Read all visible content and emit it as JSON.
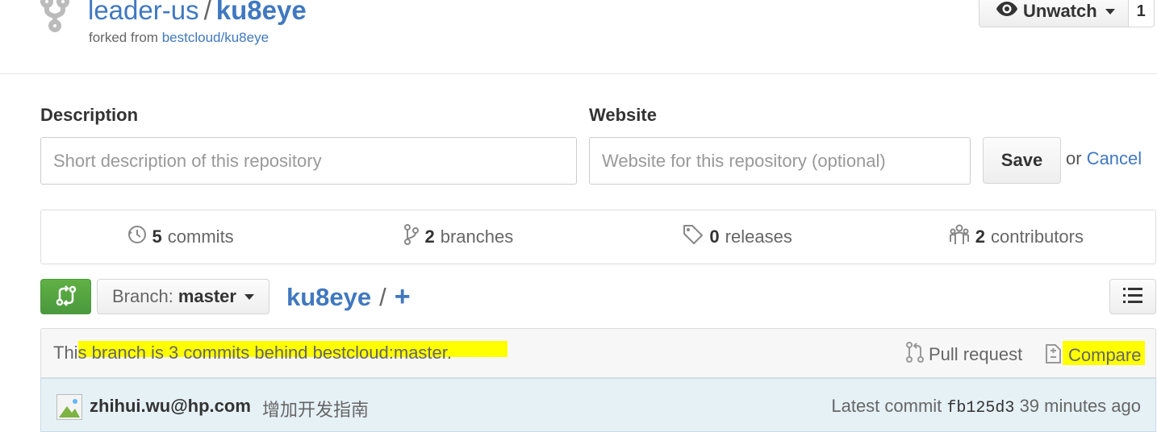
{
  "repo": {
    "owner": "leader-us",
    "separator": "/",
    "name": "ku8eye",
    "forked_prefix": "forked from ",
    "forked_source": "bestcloud/ku8eye"
  },
  "watch": {
    "label": "Unwatch",
    "count": "1"
  },
  "description_form": {
    "description_label": "Description",
    "description_placeholder": "Short description of this repository",
    "website_label": "Website",
    "website_placeholder": "Website for this repository (optional)",
    "save_label": "Save",
    "or_text": "or ",
    "cancel_label": "Cancel"
  },
  "numbers": {
    "commits": {
      "count": "5",
      "label": "commits"
    },
    "branches": {
      "count": "2",
      "label": "branches"
    },
    "releases": {
      "count": "0",
      "label": "releases"
    },
    "contributors": {
      "count": "2",
      "label": "contributors"
    }
  },
  "file_nav": {
    "branch_prefix": "Branch:",
    "branch_name": "master",
    "breadcrumb_root": "ku8eye",
    "breadcrumb_sep": "/",
    "add_file": "+"
  },
  "compare_bar": {
    "status_text": "This branch is 3 commits behind bestcloud:master.",
    "pull_request_label": "Pull request",
    "compare_label": "Compare",
    "highlight_color": "#ffff00"
  },
  "latest_commit": {
    "author": "zhihui.wu@hp.com",
    "message": "增加开发指南",
    "prefix": "Latest commit",
    "sha": "fb125d3",
    "time": "39 minutes ago"
  },
  "colors": {
    "link": "#4078c0",
    "primary_button": "#60b044",
    "commit_bar_bg": "#e6f1f6"
  }
}
